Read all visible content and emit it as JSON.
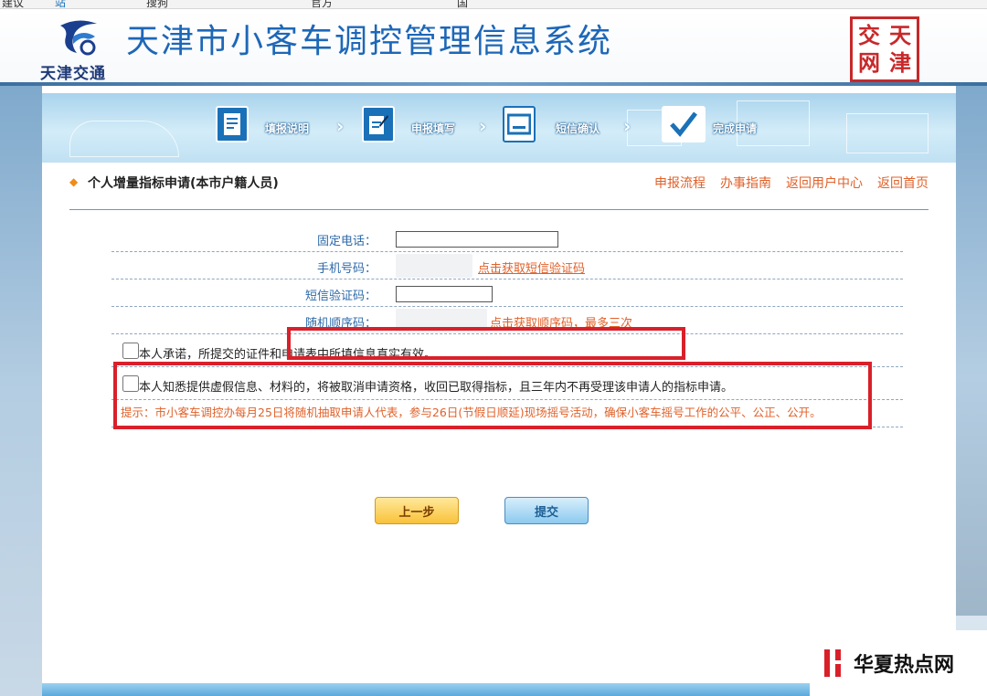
{
  "browser": {
    "fav_fragments": [
      "建议",
      "站",
      "搜狗",
      "官方",
      "国"
    ]
  },
  "header": {
    "logo_caption": "天津交通",
    "title": "天津市小客车调控管理信息系统",
    "seal_chars": [
      "天",
      "交",
      "津",
      "网"
    ]
  },
  "steps": [
    {
      "label": "填报说明",
      "icon": "document-icon"
    },
    {
      "label": "申报填写",
      "icon": "edit-icon"
    },
    {
      "label": "短信确认",
      "icon": "message-icon"
    },
    {
      "label": "完成申请",
      "icon": "checkmark-icon"
    }
  ],
  "section": {
    "title": "个人增量指标申请(本市户籍人员)",
    "links": [
      "申报流程",
      "办事指南",
      "返回用户中心",
      "返回首页"
    ]
  },
  "form": {
    "landline_label": "固定电话：",
    "landline_value": "",
    "mobile_label": "手机号码：",
    "get_sms_code_link": "点击获取短信验证码",
    "sms_code_label": "短信验证码：",
    "sms_code_value": "",
    "random_seq_label": "随机顺序码：",
    "get_random_seq_link": "点击获取顺序码，最多三次"
  },
  "declarations": [
    "本人承诺，所提交的证件和申请表中所填信息真实有效。",
    "本人知悉提供虚假信息、材料的，将被取消申请资格，收回已取得指标，且三年内不再受理该申请人的指标申请。"
  ],
  "tip": "提示：市小客车调控办每月25日将随机抽取申请人代表，参与26日(节假日顺延)现场摇号活动，确保小客车摇号工作的公平、公正、公开。",
  "buttons": {
    "prev": "上一步",
    "submit": "提交"
  },
  "watermark": "华夏热点网",
  "colors": {
    "title_blue": "#1d67b8",
    "link_orange": "#e0612a",
    "highlight_red": "#d9202a",
    "label_blue": "#2e6aa8"
  }
}
